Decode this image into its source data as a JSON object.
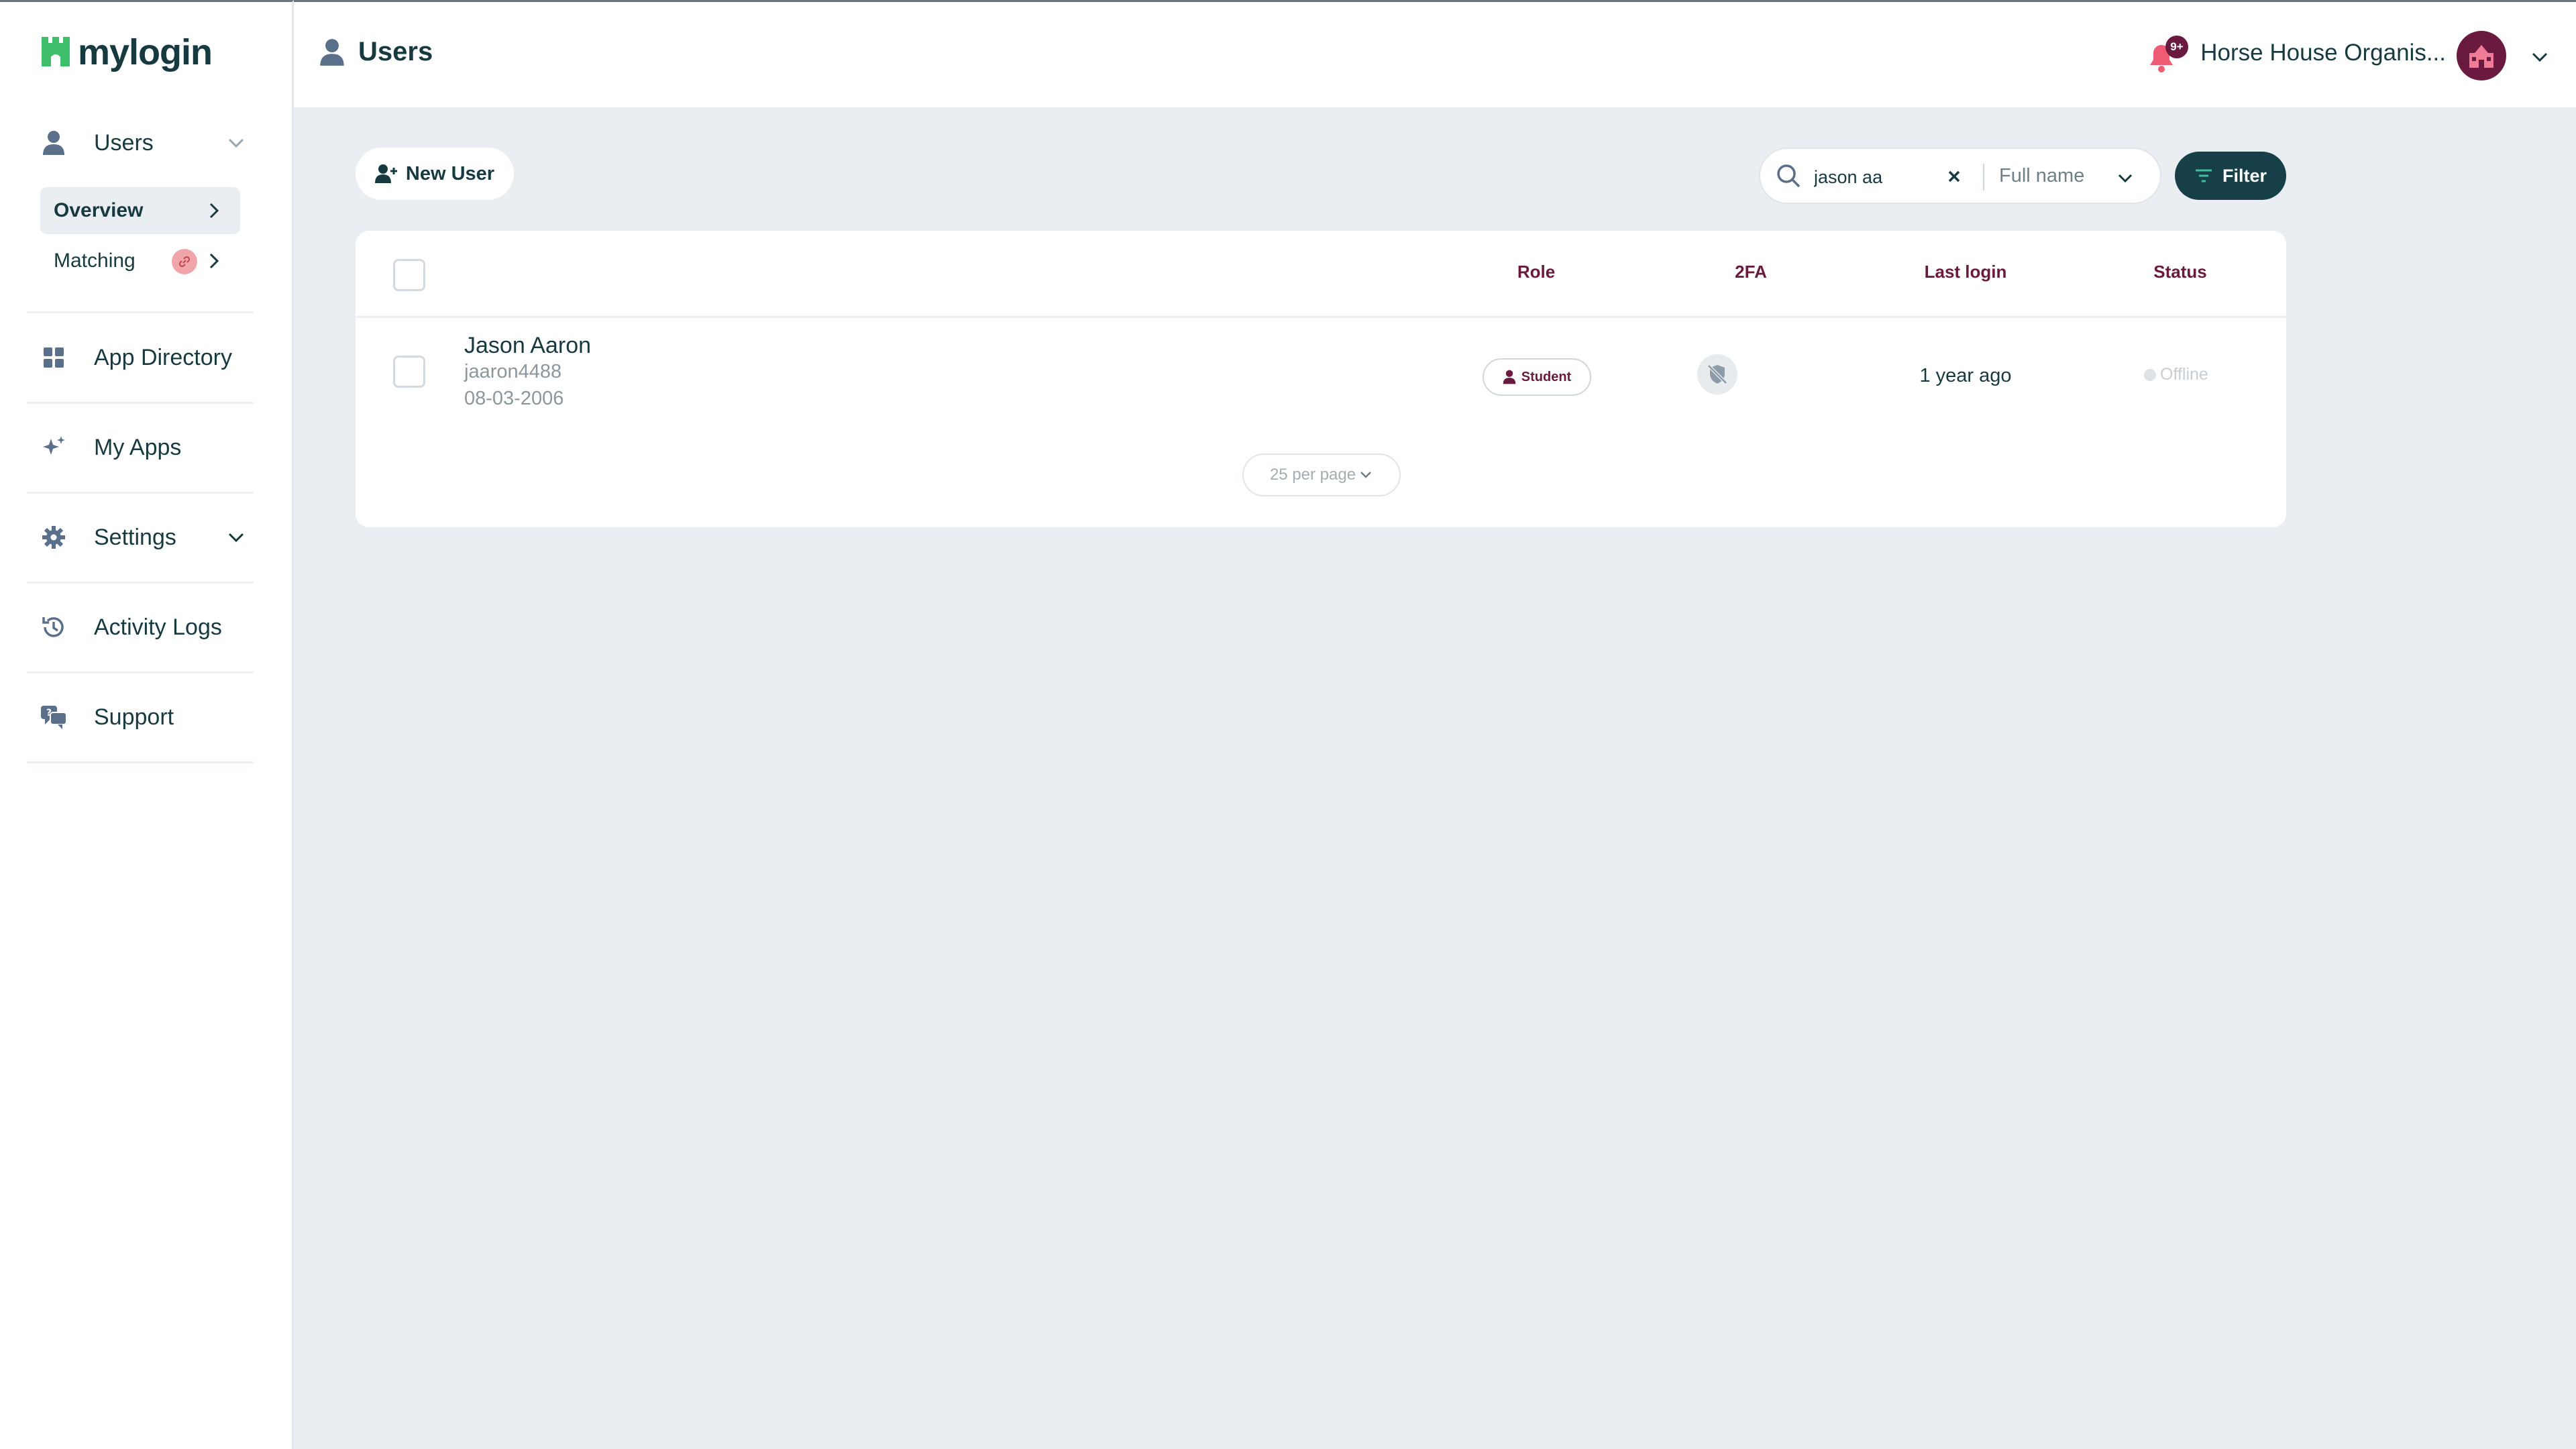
{
  "brand": {
    "name": "mylogin",
    "accent": "#3fbf6b",
    "dark": "#173a40",
    "plum": "#6a1a3e"
  },
  "sidebar": {
    "items": [
      {
        "label": "Users",
        "icon": "user-icon"
      },
      {
        "label": "App Directory",
        "icon": "grid-icon"
      },
      {
        "label": "My Apps",
        "icon": "sparkle-icon"
      },
      {
        "label": "Settings",
        "icon": "gear-icon"
      },
      {
        "label": "Activity Logs",
        "icon": "history-icon"
      },
      {
        "label": "Support",
        "icon": "chat-help-icon"
      }
    ],
    "users_sub": [
      {
        "label": "Overview",
        "active": true
      },
      {
        "label": "Matching",
        "badge_icon": "link-icon"
      }
    ]
  },
  "header": {
    "title": "Users",
    "notifications_count": "9+",
    "org_name": "Horse House Organis..."
  },
  "toolbar": {
    "new_user_label": "New User",
    "search_value": "jason aa",
    "search_field": "Full name",
    "filter_label": "Filter"
  },
  "table": {
    "columns": {
      "role": "Role",
      "twofa": "2FA",
      "last_login": "Last login",
      "status": "Status"
    },
    "rows": [
      {
        "name": "Jason Aaron",
        "username": "jaaron4488",
        "dob": "08-03-2006",
        "role": "Student",
        "twofa": "disabled",
        "last_login": "1 year ago",
        "status": "Offline"
      }
    ],
    "per_page": "25 per page"
  }
}
